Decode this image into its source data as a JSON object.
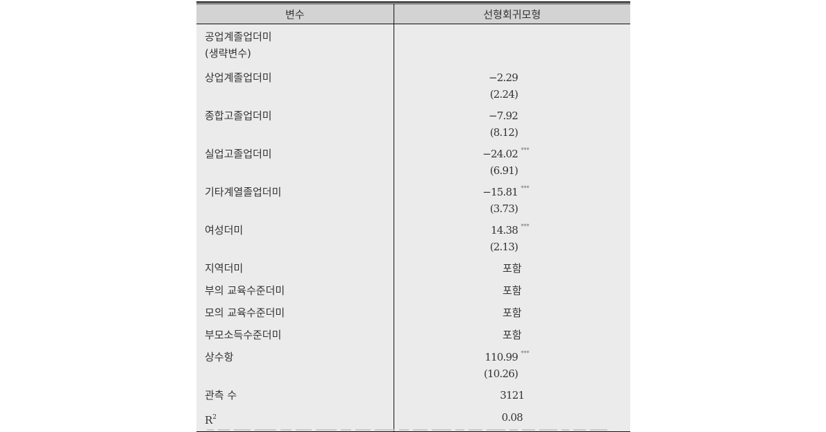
{
  "table": {
    "headers": [
      "변수",
      "선형회귀모형"
    ],
    "rows": [
      {
        "var_lines": [
          "공업계졸업더미",
          "(생략변수)"
        ],
        "coef": "",
        "se": "",
        "stars": ""
      },
      {
        "var_lines": [
          "상업계졸업더미"
        ],
        "coef": "−2.29",
        "se": "(2.24)",
        "stars": ""
      },
      {
        "var_lines": [
          "종합고졸업더미"
        ],
        "coef": "−7.92",
        "se": "(8.12)",
        "stars": ""
      },
      {
        "var_lines": [
          "실업고졸업더미"
        ],
        "coef": "−24.02",
        "se": "(6.91)",
        "stars": "***"
      },
      {
        "var_lines": [
          "기타계열졸업더미"
        ],
        "coef": "−15.81",
        "se": "(3.73)",
        "stars": "***"
      },
      {
        "var_lines": [
          "여성더미"
        ],
        "coef": "14.38",
        "se": "(2.13)",
        "stars": "***"
      },
      {
        "var_lines": [
          "지역더미"
        ],
        "value": "포함"
      },
      {
        "var_lines": [
          "부의 교육수준더미"
        ],
        "value": "포함"
      },
      {
        "var_lines": [
          "모의 교육수준더미"
        ],
        "value": "포함"
      },
      {
        "var_lines": [
          "부모소득수준더미"
        ],
        "value": "포함"
      },
      {
        "var_lines": [
          "상수항"
        ],
        "coef": "110.99",
        "se": "(10.26)",
        "stars": "***"
      },
      {
        "var_lines": [
          "관측 수"
        ],
        "value": "3121"
      },
      {
        "var_lines": [
          "R",
          "2"
        ],
        "value": "0.08",
        "is_r2": true
      }
    ]
  },
  "footnote": {
    "visible": "partial"
  }
}
